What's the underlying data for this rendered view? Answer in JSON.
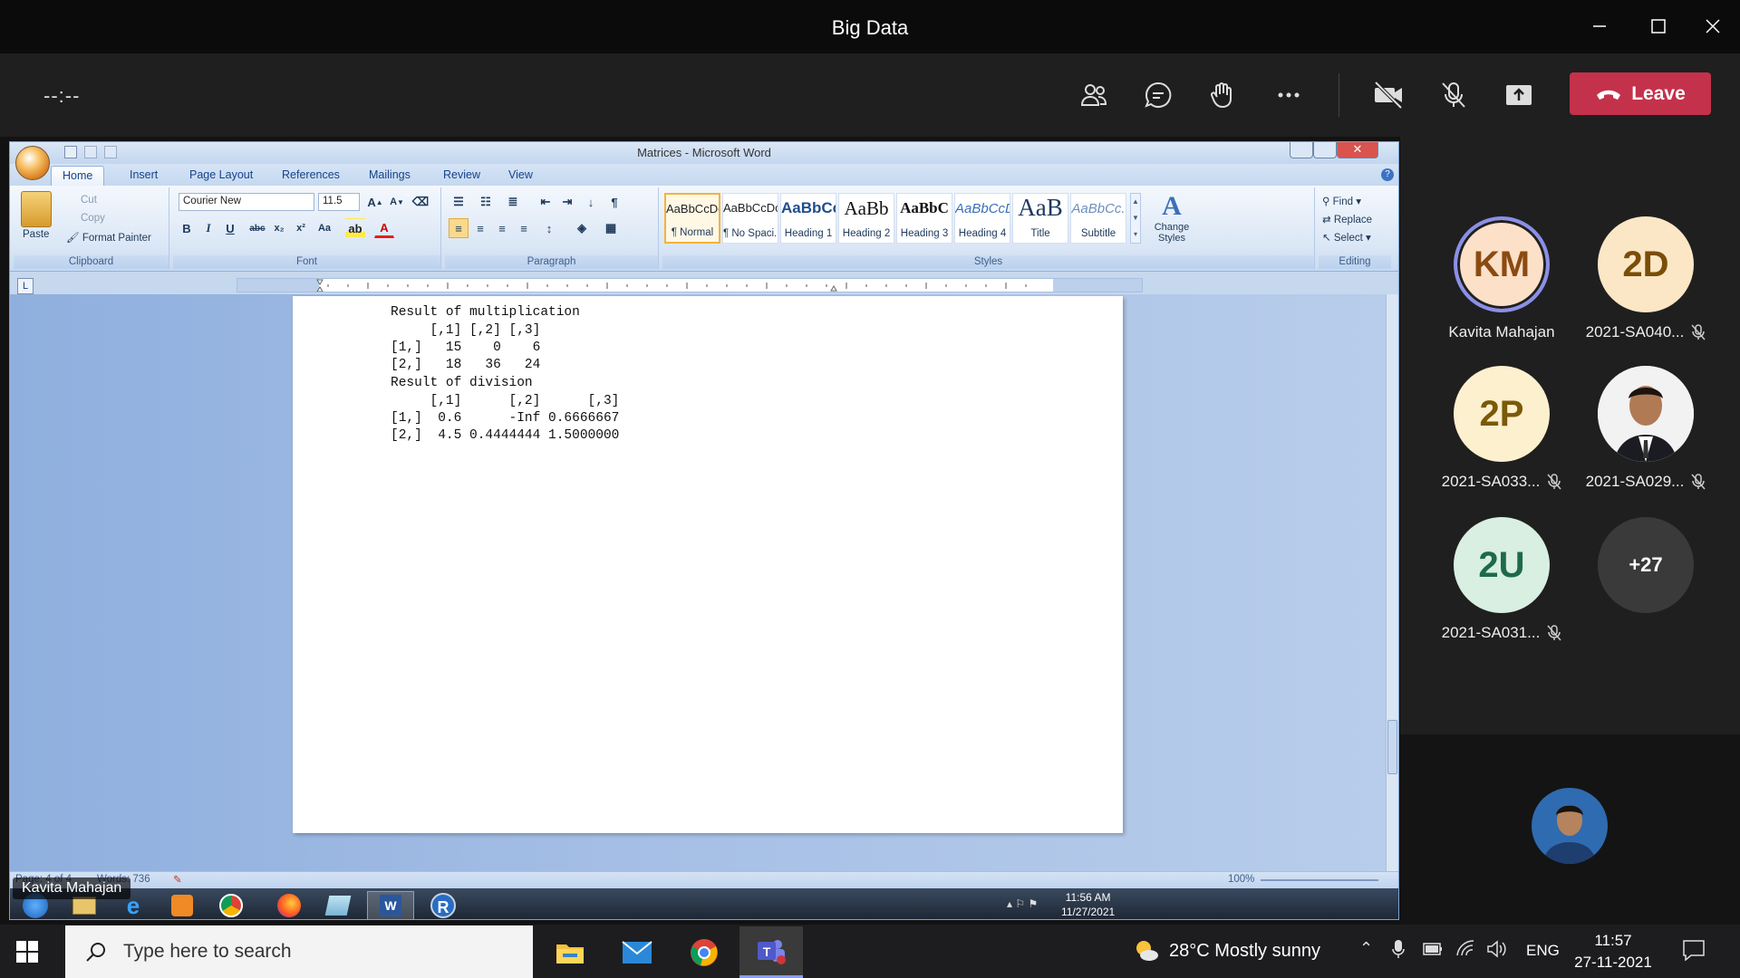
{
  "teams": {
    "window_title": "Big Data",
    "timer": "--:--",
    "leave_label": "Leave"
  },
  "word": {
    "title": "Matrices - Microsoft Word",
    "tabs": [
      "Home",
      "Insert",
      "Page Layout",
      "References",
      "Mailings",
      "Review",
      "View"
    ],
    "clipboard": {
      "paste": "Paste",
      "cut": "Cut",
      "copy": "Copy",
      "format_painter": "Format Painter",
      "label": "Clipboard"
    },
    "font": {
      "name": "Courier New",
      "size": "11.5",
      "label": "Font"
    },
    "paragraph_label": "Paragraph",
    "styles": [
      {
        "preview": "AaBbCcDc",
        "name": "¶ Normal"
      },
      {
        "preview": "AaBbCcDc",
        "name": "¶ No Spaci..."
      },
      {
        "preview": "AaBbCc",
        "name": "Heading 1"
      },
      {
        "preview": "AaBb",
        "name": "Heading 2"
      },
      {
        "preview": "AaBbC",
        "name": "Heading 3"
      },
      {
        "preview": "AaBbCcD",
        "name": "Heading 4"
      },
      {
        "preview": "AaB",
        "name": "Title"
      },
      {
        "preview": "AaBbCc.",
        "name": "Subtitle"
      }
    ],
    "styles_label": "Styles",
    "change_styles": "Change Styles",
    "editing": {
      "find": "Find",
      "replace": "Replace",
      "select": "Select",
      "label": "Editing"
    },
    "document_lines": [
      "Result of multiplication",
      "     [,1] [,2] [,3]",
      "[1,]   15    0    6",
      "[2,]   18   36   24",
      "Result of division",
      "     [,1]      [,2]      [,3]",
      "[1,]  0.6      -Inf 0.6666667",
      "[2,]  4.5 0.4444444 1.5000000"
    ],
    "status": {
      "page": "Page: 4 of 4",
      "words": "Words: 736",
      "zoom": "100%"
    },
    "inner_clock": {
      "time": "11:56 AM",
      "date": "11/27/2021"
    }
  },
  "presenter_label": "Kavita Mahajan",
  "participants": [
    {
      "initials": "KM",
      "name": "Kavita Mahajan",
      "muted": false,
      "bg": "#fde0c8",
      "fg": "#8a4b12",
      "speaking": true
    },
    {
      "initials": "2D",
      "name": "2021-SA040...",
      "muted": true,
      "bg": "#fbe7c6",
      "fg": "#7a4d08"
    },
    {
      "initials": "2P",
      "name": "2021-SA033...",
      "muted": true,
      "bg": "#fdf0cf",
      "fg": "#7a5a08"
    },
    {
      "initials": "",
      "name": "2021-SA029...",
      "muted": true,
      "photo": true
    },
    {
      "initials": "2U",
      "name": "2021-SA031...",
      "muted": true,
      "bg": "#d8efe2",
      "fg": "#1e6b48"
    },
    {
      "initials": "+27",
      "name": "",
      "muted": false,
      "bg": "#3a3a3a",
      "fg": "#ffffff"
    }
  ],
  "taskbar": {
    "search_placeholder": "Type here to search",
    "weather": "28°C  Mostly sunny",
    "language": "ENG",
    "time": "11:57",
    "date": "27-11-2021"
  }
}
